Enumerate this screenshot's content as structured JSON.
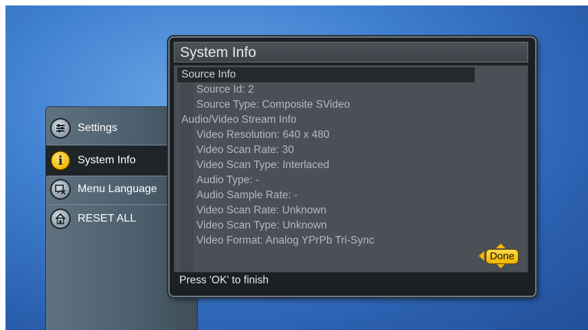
{
  "menu": {
    "items": [
      {
        "label": "Settings",
        "icon": "settings-sliders-icon"
      },
      {
        "label": "System Info",
        "icon": "info-icon"
      },
      {
        "label": "Menu Language",
        "icon": "language-icon"
      },
      {
        "label": "RESET ALL",
        "icon": "home-reset-icon"
      }
    ],
    "selected": "System Info"
  },
  "dialog": {
    "title": "System Info",
    "lines": [
      "Source Info",
      "Source Id: 2",
      "Source Type: Composite SVideo",
      "Audio/Video Stream Info",
      "Video Resolution: 640 x 480",
      "Video Scan Rate: 30",
      "Video Scan Type: Interlaced",
      "Audio Type: -",
      "Audio Sample Rate: -",
      "Video Scan Rate: Unknown",
      "Video Scan Type: Unknown",
      "Video Format: Analog YPrPb Tri-Sync"
    ],
    "footer": "Press 'OK' to finish",
    "done_label": "Done"
  },
  "colors": {
    "accent": "#f1b600",
    "background": "#3f7fd0",
    "panel": "#4a5056"
  }
}
